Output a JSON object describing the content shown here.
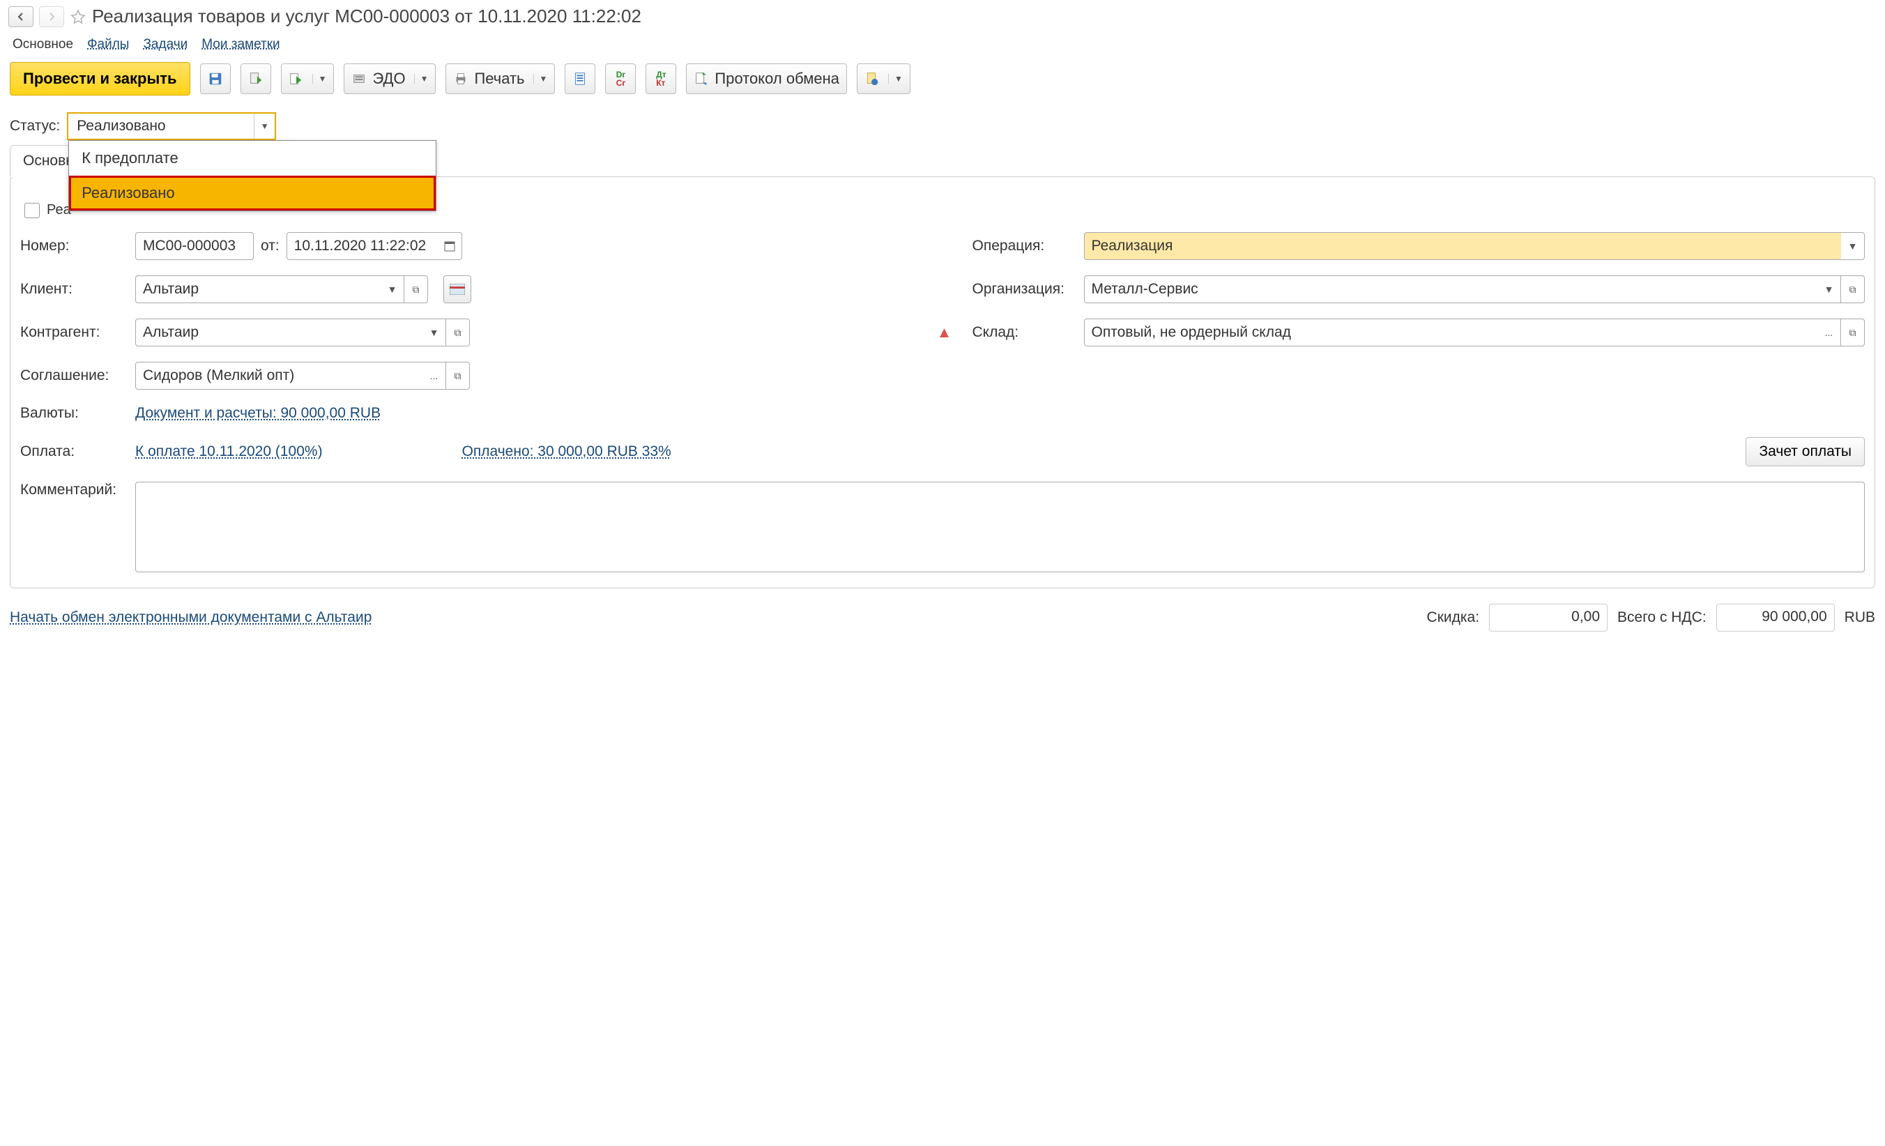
{
  "header": {
    "title": "Реализация товаров и услуг МС00-000003 от 10.11.2020 11:22:02"
  },
  "tabs": {
    "main": "Основное",
    "files": "Файлы",
    "tasks": "Задачи",
    "notes": "Мои заметки"
  },
  "actions": {
    "post_close": "Провести и закрыть",
    "edo": "ЭДО",
    "print": "Печать",
    "protocol": "Протокол обмена"
  },
  "status": {
    "label": "Статус:",
    "value": "Реализовано",
    "options": {
      "prepay": "К предоплате",
      "done": "Реализовано"
    }
  },
  "panel_tab": "Основн",
  "checkbox_label": "Реа",
  "fields": {
    "number_label": "Номер:",
    "number_value": "МС00-000003",
    "date_label": "от:",
    "date_value": "10.11.2020 11:22:02",
    "operation_label": "Операция:",
    "operation_value": "Реализация",
    "client_label": "Клиент:",
    "client_value": "Альтаир",
    "org_label": "Организация:",
    "org_value": "Металл-Сервис",
    "contragent_label": "Контрагент:",
    "contragent_value": "Альтаир",
    "warehouse_label": "Склад:",
    "warehouse_value": "Оптовый, не ордерный склад",
    "agreement_label": "Соглашение:",
    "agreement_value": "Сидоров (Мелкий опт)",
    "currency_label": "Валюты:",
    "currency_link": "Документ и расчеты: 90 000,00 RUB",
    "payment_label": "Оплата:",
    "payment_link": "К оплате 10.11.2020 (100%)",
    "paid_link": "Оплачено: 30 000,00 RUB  33%",
    "offset_btn": "Зачет оплаты",
    "comment_label": "Комментарий:"
  },
  "footer": {
    "edi_link": "Начать обмен электронными документами с Альтаир",
    "discount_label": "Скидка:",
    "discount_value": "0,00",
    "total_label": "Всего с НДС:",
    "total_value": "90 000,00",
    "currency": "RUB"
  }
}
